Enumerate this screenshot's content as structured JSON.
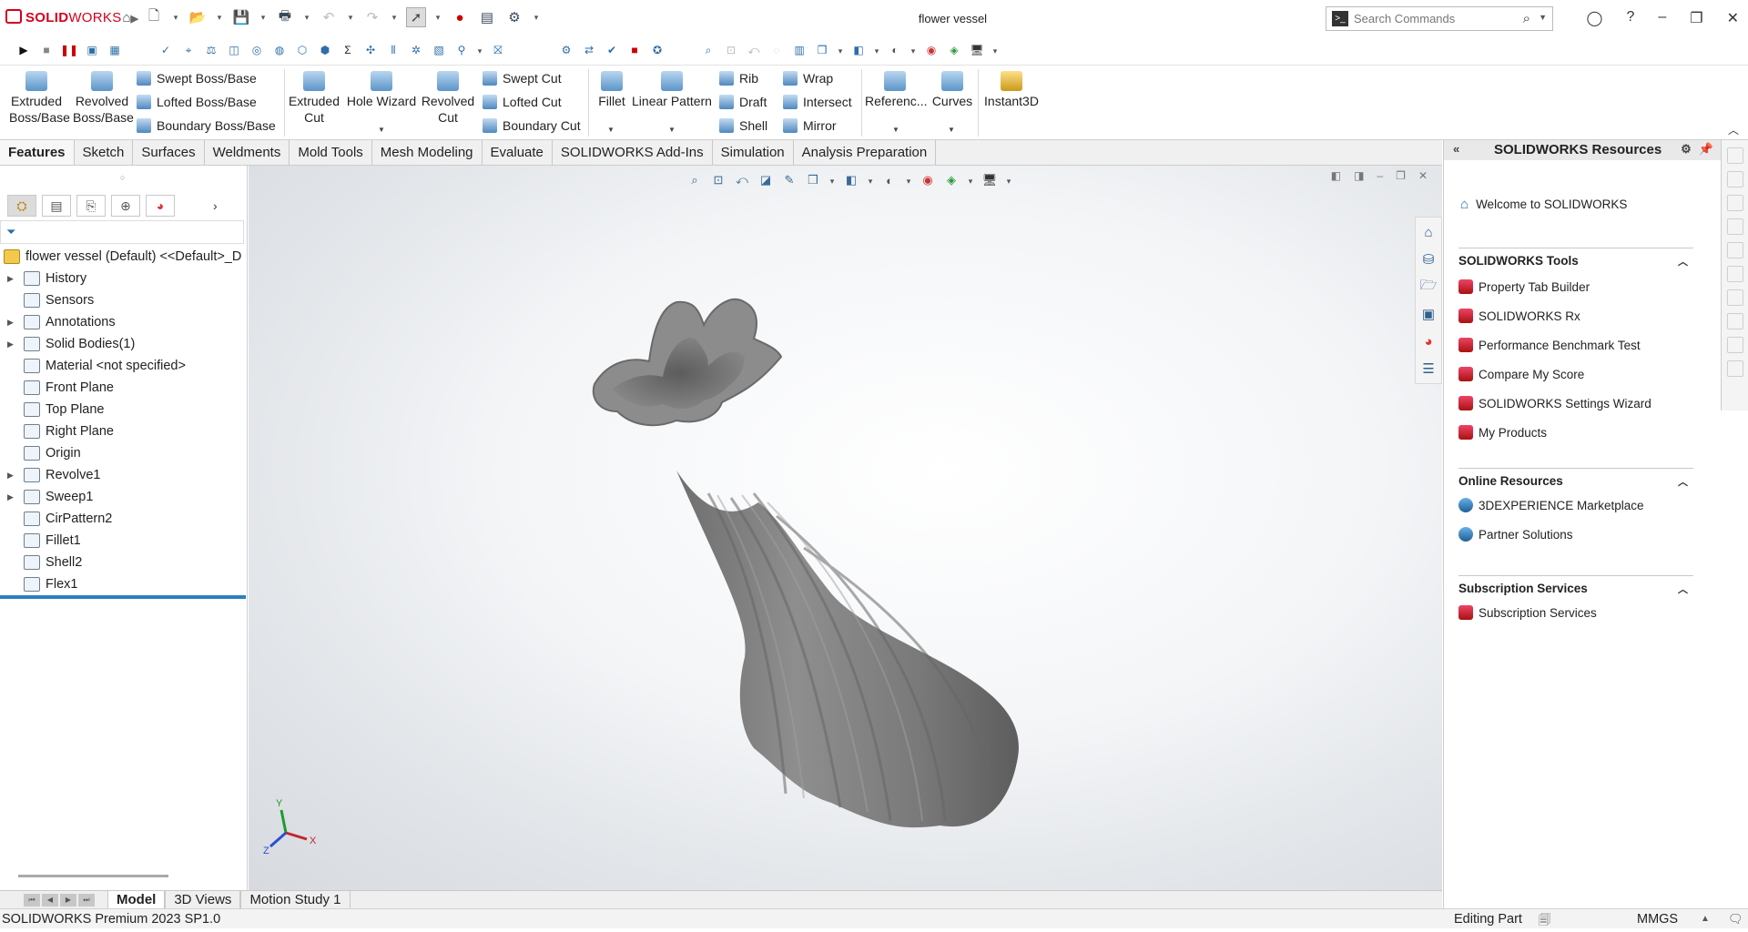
{
  "app": {
    "logo_prefix": "SOLID",
    "logo_suffix": "WORKS",
    "document_title": "flower vessel",
    "search_placeholder": "Search Commands"
  },
  "command_manager": {
    "extruded_boss": "Extruded\nBoss/Base",
    "revolved_boss": "Revolved\nBoss/Base",
    "swept_boss": "Swept Boss/Base",
    "lofted_boss": "Lofted Boss/Base",
    "boundary_boss": "Boundary Boss/Base",
    "extruded_cut": "Extruded\nCut",
    "hole_wizard": "Hole Wizard",
    "revolved_cut": "Revolved\nCut",
    "swept_cut": "Swept Cut",
    "lofted_cut": "Lofted Cut",
    "boundary_cut": "Boundary Cut",
    "fillet": "Fillet",
    "linear_pattern": "Linear Pattern",
    "rib": "Rib",
    "draft": "Draft",
    "shell": "Shell",
    "wrap": "Wrap",
    "intersect": "Intersect",
    "mirror": "Mirror",
    "reference": "Referenc...",
    "curves": "Curves",
    "instant3d": "Instant3D"
  },
  "tabs": [
    "Features",
    "Sketch",
    "Surfaces",
    "Weldments",
    "Mold Tools",
    "Mesh Modeling",
    "Evaluate",
    "SOLIDWORKS Add-Ins",
    "Simulation",
    "Analysis Preparation"
  ],
  "active_tab": "Features",
  "feature_tree": {
    "root": "flower vessel (Default) <<Default>_D",
    "nodes": [
      {
        "label": "History",
        "expandable": true
      },
      {
        "label": "Sensors",
        "expandable": false
      },
      {
        "label": "Annotations",
        "expandable": true
      },
      {
        "label": "Solid Bodies(1)",
        "expandable": true
      },
      {
        "label": "Material <not specified>",
        "expandable": false
      },
      {
        "label": "Front Plane",
        "expandable": false
      },
      {
        "label": "Top Plane",
        "expandable": false
      },
      {
        "label": "Right Plane",
        "expandable": false
      },
      {
        "label": "Origin",
        "expandable": false
      },
      {
        "label": "Revolve1",
        "expandable": true
      },
      {
        "label": "Sweep1",
        "expandable": true
      },
      {
        "label": "CirPattern2",
        "expandable": false
      },
      {
        "label": "Fillet1",
        "expandable": false
      },
      {
        "label": "Shell2",
        "expandable": false
      },
      {
        "label": "Flex1",
        "expandable": false
      }
    ]
  },
  "triad": {
    "x": "X",
    "y": "Y",
    "z": "Z"
  },
  "resources": {
    "title": "SOLIDWORKS Resources",
    "welcome": "Welcome to SOLIDWORKS",
    "tools_header": "SOLIDWORKS Tools",
    "tools": [
      "Property Tab Builder",
      "SOLIDWORKS Rx",
      "Performance Benchmark Test",
      "Compare My Score",
      "SOLIDWORKS Settings Wizard",
      "My Products"
    ],
    "online_header": "Online Resources",
    "online": [
      "3DEXPERIENCE Marketplace",
      "Partner Solutions"
    ],
    "subscription_header": "Subscription Services",
    "subscription": [
      "Subscription Services"
    ]
  },
  "bottom_tabs": [
    "Model",
    "3D Views",
    "Motion Study 1"
  ],
  "status": {
    "version": "SOLIDWORKS Premium 2023 SP1.0",
    "mode": "Editing Part",
    "units": "MMGS"
  },
  "colors": {
    "brand_red": "#d6001c",
    "tree_selection": "#2a7fc4",
    "vessel_gray": "#7a7a7a"
  }
}
